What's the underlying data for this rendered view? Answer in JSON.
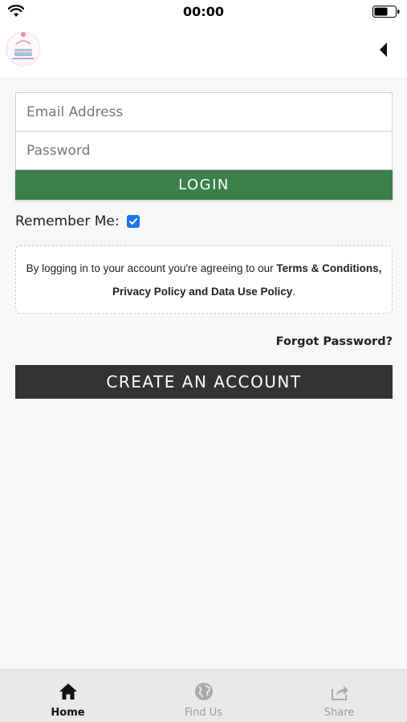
{
  "status_bar": {
    "time": "00:00"
  },
  "header": {
    "logo_icon": "cake-logo-icon",
    "back_icon": "back-arrow-icon"
  },
  "login_form": {
    "email_placeholder": "Email Address",
    "password_placeholder": "Password",
    "login_label": "LOGIN",
    "remember_label": "Remember Me:",
    "remember_checked": true
  },
  "terms": {
    "prefix": "By logging in to your account you're agreeing to our ",
    "terms_link": "Terms & Conditions,",
    "policy_link": "Privacy Policy and Data Use Policy",
    "suffix": "."
  },
  "forgot_password": "Forgot Password?",
  "create_account": "CREATE AN ACCOUNT",
  "tab_bar": {
    "tabs": [
      {
        "label": "Home",
        "icon": "home-icon",
        "active": true
      },
      {
        "label": "Find Us",
        "icon": "globe-icon",
        "active": false
      },
      {
        "label": "Share",
        "icon": "share-icon",
        "active": false
      }
    ]
  },
  "colors": {
    "login_button": "#3b7f4a",
    "create_button": "#333333",
    "checkbox": "#1a73e8"
  }
}
